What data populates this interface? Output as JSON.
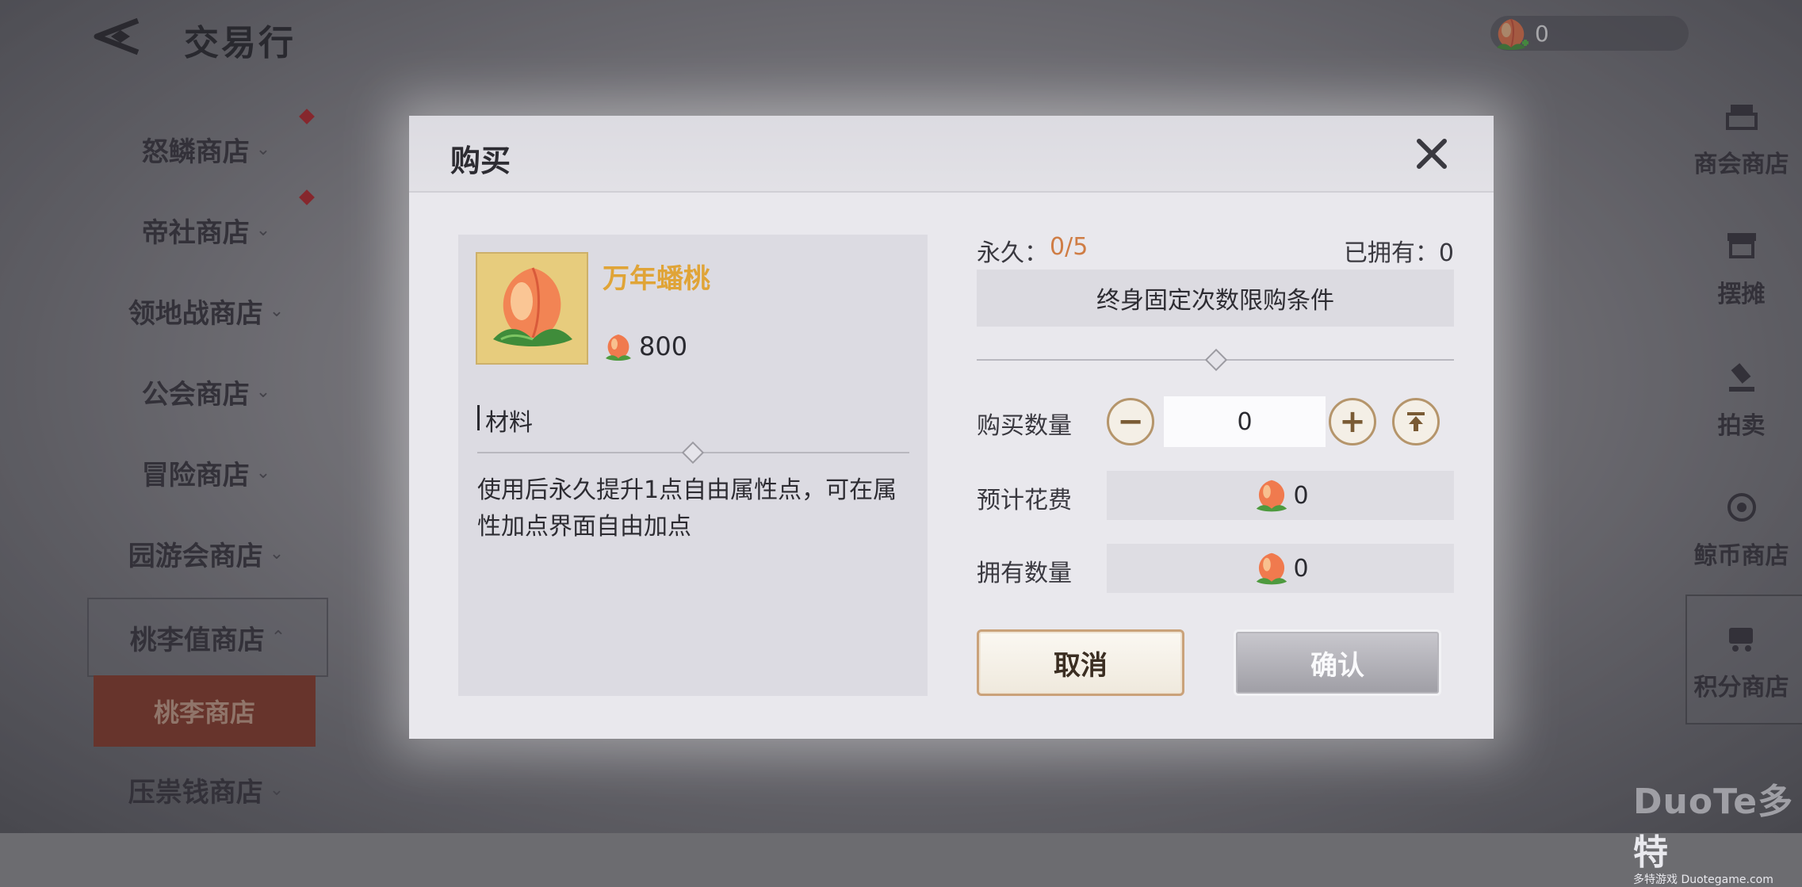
{
  "header": {
    "title": "交易行"
  },
  "currency": {
    "value": "0",
    "icon": "peach-icon"
  },
  "sidebar": {
    "items": [
      {
        "label": "怒鳞商店"
      },
      {
        "label": "帝社商店"
      },
      {
        "label": "领地战商店"
      },
      {
        "label": "公会商店"
      },
      {
        "label": "冒险商店"
      },
      {
        "label": "园游会商店"
      },
      {
        "label": "桃李值商店"
      },
      {
        "label": "压祟钱商店"
      }
    ],
    "sub_item": "桃李商店"
  },
  "right_nav": {
    "items": [
      {
        "label": "商会商店",
        "icon": "guild-shop-icon"
      },
      {
        "label": "摆摊",
        "icon": "stall-icon"
      },
      {
        "label": "拍卖",
        "icon": "auction-gavel-icon"
      },
      {
        "label": "鲸币商店",
        "icon": "coin-icon"
      },
      {
        "label": "积分商店",
        "icon": "points-cart-icon"
      }
    ]
  },
  "dialog": {
    "title": "购买",
    "item": {
      "name": "万年蟠桃",
      "price": "800",
      "category": "材料",
      "description": "使用后永久提升1点自由属性点，可在属性加点界面自由加点"
    },
    "permanent_label": "永久：",
    "permanent_value": "0/5",
    "owned_label": "已拥有：0",
    "limit_text": "终身固定次数限购条件",
    "quantity_label": "购买数量",
    "quantity_value": "0",
    "cost_label": "预计花费",
    "cost_value": "0",
    "own_qty_label": "拥有数量",
    "own_qty_value": "0",
    "cancel_label": "取消",
    "confirm_label": "确认"
  },
  "watermark": {
    "brand": "DuoTe多特",
    "sub": "多特游戏 Duotegame.com"
  },
  "colors": {
    "item_name": "#e0a437",
    "permanent_value": "#cf7d45",
    "active_sub_tab": "#8e3d2a"
  }
}
